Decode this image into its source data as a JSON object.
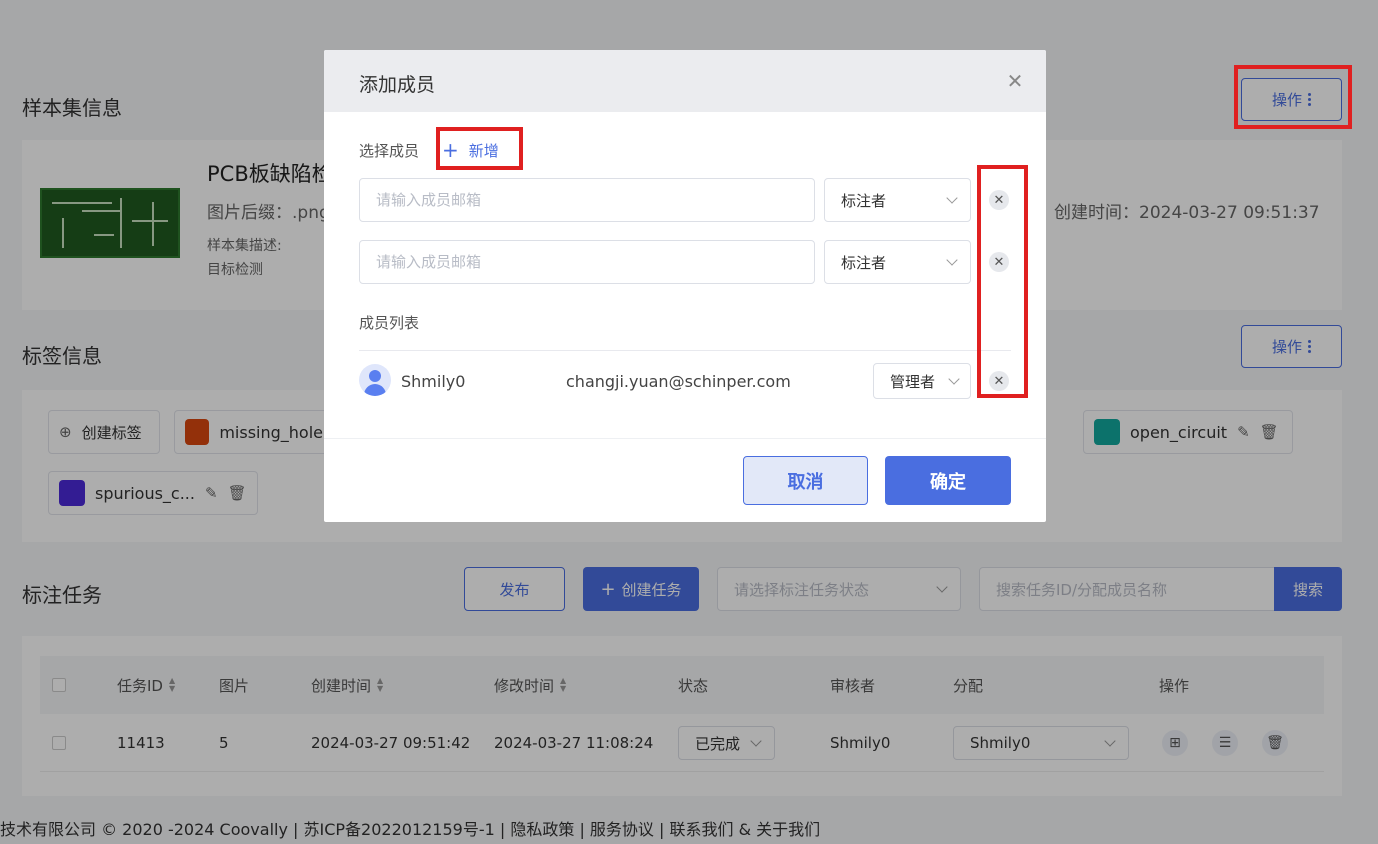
{
  "background": {
    "sample_set": {
      "section_title": "样本集信息",
      "op_button": "操作",
      "name": "PCB板缺陷检",
      "suffix": "图片后缀：.png",
      "created": "创建时间：2024-03-27 09:51:37",
      "desc_label": "样本集描述:",
      "task_type": "目标检测"
    },
    "tags": {
      "section_title": "标签信息",
      "op_button": "操作",
      "create_label": "创建标签",
      "items": [
        {
          "label": "missing_hole",
          "color": "#d9480f"
        },
        {
          "label": "open_circuit",
          "color": "#12a89e"
        },
        {
          "label": "spurious_c...",
          "color": "#4c2ad9"
        }
      ]
    },
    "tasks": {
      "section_title": "标注任务",
      "publish": "发布",
      "create": "创建任务",
      "status_placeholder": "请选择标注任务状态",
      "search_placeholder": "搜索任务ID/分配成员名称",
      "search_button": "搜索",
      "columns": [
        "任务ID",
        "图片",
        "创建时间",
        "修改时间",
        "状态",
        "审核者",
        "分配",
        "操作"
      ],
      "rows": [
        {
          "id": "11413",
          "images": "5",
          "created": "2024-03-27 09:51:42",
          "modified": "2024-03-27 11:08:24",
          "status": "已完成",
          "reviewer": "Shmily0",
          "assignee": "Shmily0"
        }
      ]
    },
    "footer": "技术有限公司 © 2020 -2024 Coovally | 苏ICP备2022012159号-1 | 隐私政策 | 服务协议 | 联系我们 & 关于我们"
  },
  "modal": {
    "title": "添加成员",
    "select_label": "选择成员",
    "add_label": "新增",
    "inputs": [
      {
        "placeholder": "请输入成员邮箱",
        "role": "标注者"
      },
      {
        "placeholder": "请输入成员邮箱",
        "role": "标注者"
      }
    ],
    "list_label": "成员列表",
    "members": [
      {
        "name": "Shmily0",
        "email": "changji.yuan@schinper.com",
        "role": "管理者"
      }
    ],
    "cancel": "取消",
    "ok": "确定"
  },
  "colors": {
    "accent": "#4a6ee0",
    "highlight": "#e02020"
  }
}
